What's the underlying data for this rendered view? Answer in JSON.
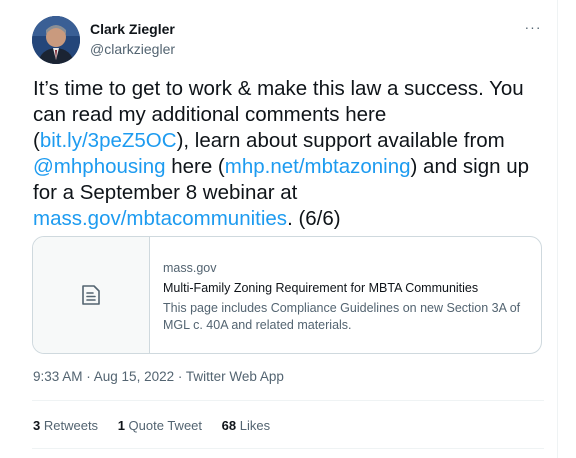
{
  "author": {
    "name": "Clark Ziegler",
    "handle": "@clarkziegler"
  },
  "more_label": "···",
  "tweet": {
    "t1": "It’s time to get to work & make this law a success.  You can read my additional comments here (",
    "link1": "bit.ly/3peZ5OC",
    "t2": "), learn about support available from ",
    "mention": "@mhphousing",
    "t3": " here (",
    "link2": "mhp.net/mbtazoning",
    "t4": ") and sign up for a September 8 webinar at ",
    "link3": "mass.gov/mbtacommunities",
    "t5": ". (6/6)"
  },
  "card": {
    "domain": "mass.gov",
    "title": "Multi-Family Zoning Requirement for MBTA Communities",
    "description": "This page includes Compliance Guidelines on new Section 3A of MGL c. 40A and related materials.",
    "icon": "document-icon"
  },
  "meta": "9:33 AM · Aug 15, 2022 · Twitter Web App",
  "stats": {
    "retweets_count": "3",
    "retweets_label": "Retweets",
    "quotes_count": "1",
    "quotes_label": "Quote Tweet",
    "likes_count": "68",
    "likes_label": "Likes"
  },
  "colors": {
    "link": "#1d9bf0",
    "text": "#0f1419",
    "secondary": "#536471"
  }
}
